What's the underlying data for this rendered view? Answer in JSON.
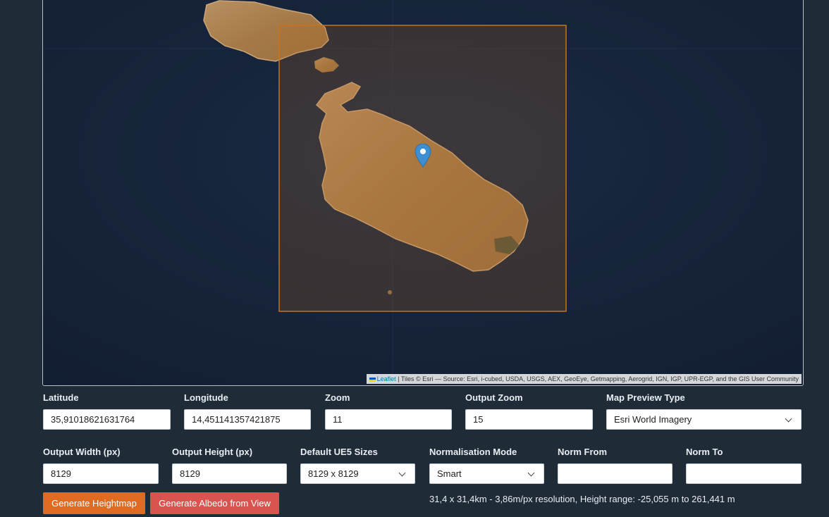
{
  "map": {
    "attribution_link": "Leaflet",
    "attribution_text": " | Tiles © Esri — Source: Esri, i-cubed, USDA, USGS, AEX, GeoEye, Getmapping, Aerogrid, IGN, IGP, UPR-EGP, and the GIS User Community",
    "marker_icon": "map-pin-icon",
    "colors": {
      "sea": "#16233a",
      "land": "#a8804f",
      "selection": "#b86a1e"
    }
  },
  "fields": {
    "latitude": {
      "label": "Latitude",
      "value": "35,91018621631764"
    },
    "longitude": {
      "label": "Longitude",
      "value": "14,451141357421875"
    },
    "zoom": {
      "label": "Zoom",
      "value": "11"
    },
    "output_zoom": {
      "label": "Output Zoom",
      "value": "15"
    },
    "map_preview_type": {
      "label": "Map Preview Type",
      "value": "Esri World Imagery"
    },
    "output_width": {
      "label": "Output Width (px)",
      "value": "8129"
    },
    "output_height": {
      "label": "Output Height (px)",
      "value": "8129"
    },
    "ue5_sizes": {
      "label": "Default UE5 Sizes",
      "value": "8129 x 8129"
    },
    "normalisation_mode": {
      "label": "Normalisation Mode",
      "value": "Smart"
    },
    "norm_from": {
      "label": "Norm From",
      "value": ""
    },
    "norm_to": {
      "label": "Norm To",
      "value": ""
    }
  },
  "buttons": {
    "generate_heightmap": {
      "label": "Generate Heightmap",
      "color": "#e06a1f"
    },
    "generate_albedo": {
      "label": "Generate Albedo from View",
      "color": "#d9534f"
    }
  },
  "status": "31,4 x 31,4km - 3,86m/px resolution, Height range: -25,055 m to 261,441 m"
}
